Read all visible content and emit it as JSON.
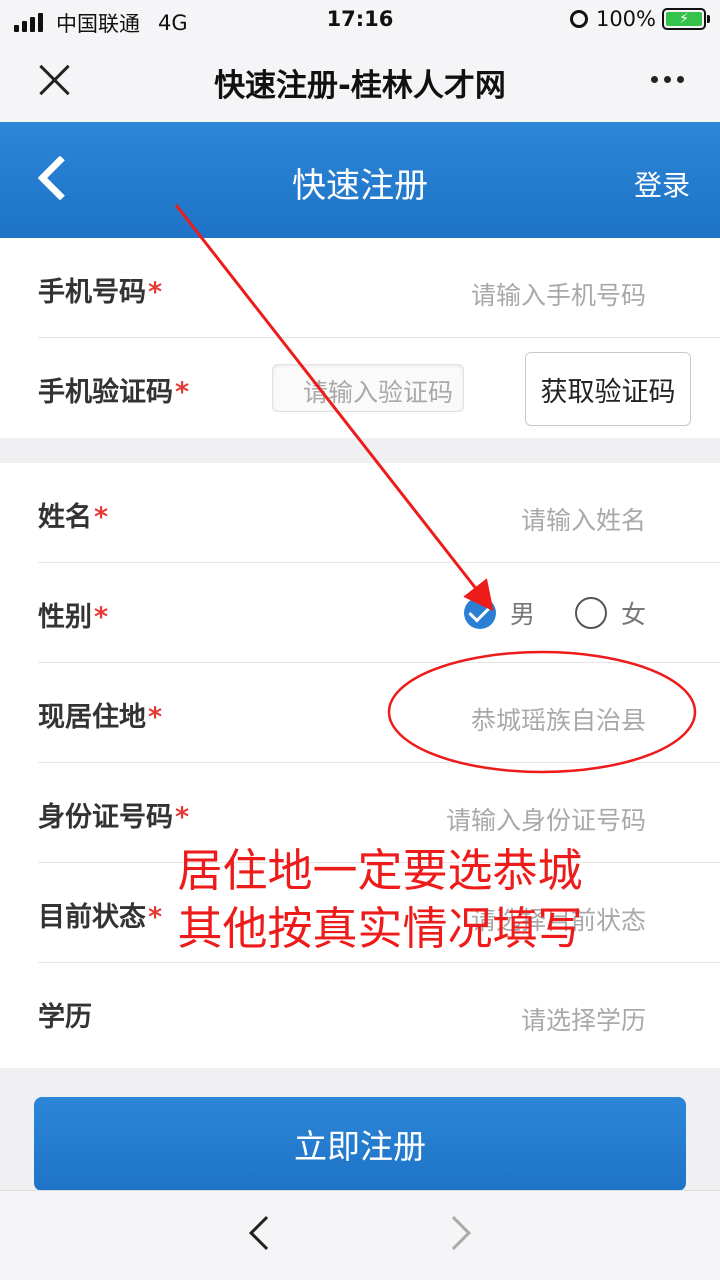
{
  "status_bar": {
    "carrier": "中国联通",
    "network": "4G",
    "time": "17:16",
    "battery": "100%"
  },
  "browser": {
    "title": "快速注册-桂林人才网"
  },
  "header": {
    "title": "快速注册",
    "login_label": "登录"
  },
  "form": {
    "required_mark": "*",
    "phone": {
      "label": "手机号码",
      "placeholder": "请输入手机号码"
    },
    "code": {
      "label": "手机验证码",
      "placeholder": "请输入验证码",
      "button": "获取验证码"
    },
    "name": {
      "label": "姓名",
      "placeholder": "请输入姓名"
    },
    "gender": {
      "label": "性别",
      "options": [
        "男",
        "女"
      ],
      "selected": "男"
    },
    "residence": {
      "label": "现居住地",
      "value": "恭城瑶族自治县"
    },
    "id_number": {
      "label": "身份证号码",
      "placeholder": "请输入身份证号码"
    },
    "status": {
      "label": "目前状态",
      "placeholder": "请选择目前状态"
    },
    "education": {
      "label": "学历",
      "placeholder": "请选择学历"
    },
    "submit_label": "立即注册"
  },
  "annotation": {
    "line1": "居住地一定要选恭城",
    "line2": "其他按真实情况填写",
    "color": "#ee1b1b"
  },
  "colors": {
    "primary": "#1e73c6",
    "required": "#e53935"
  }
}
